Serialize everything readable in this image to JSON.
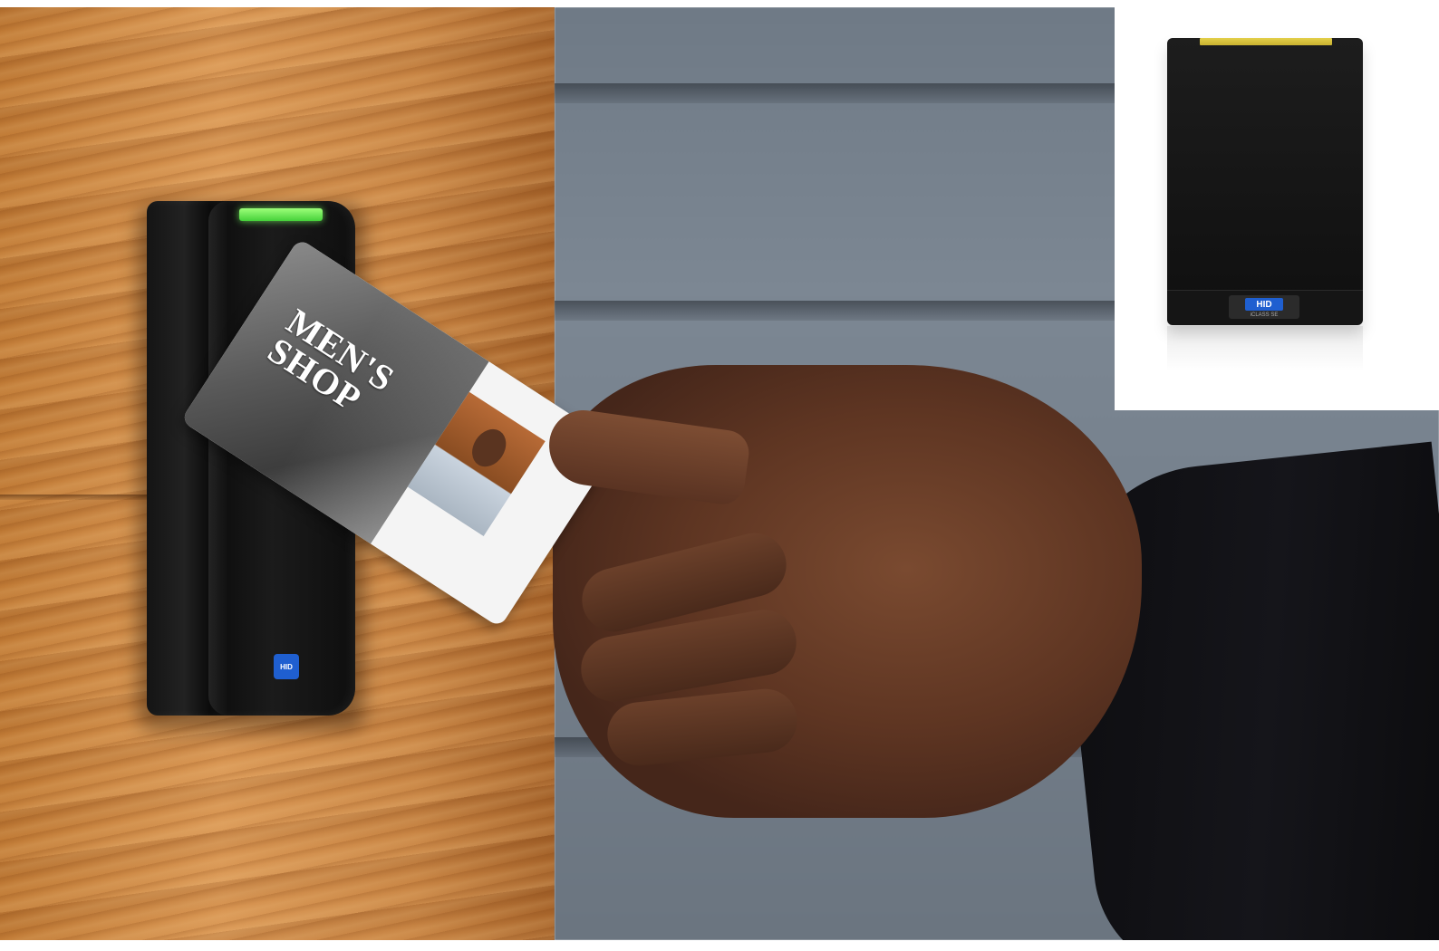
{
  "photo": {
    "card": {
      "logo_line1": "MEN'S",
      "logo_line2": "SHOP"
    },
    "wall_reader": {
      "badge": "HID",
      "led_color": "#5ee04a"
    },
    "inset_reader": {
      "brand": "HID",
      "model": "iCLASS SE",
      "led_color": "#d8c23c"
    }
  }
}
